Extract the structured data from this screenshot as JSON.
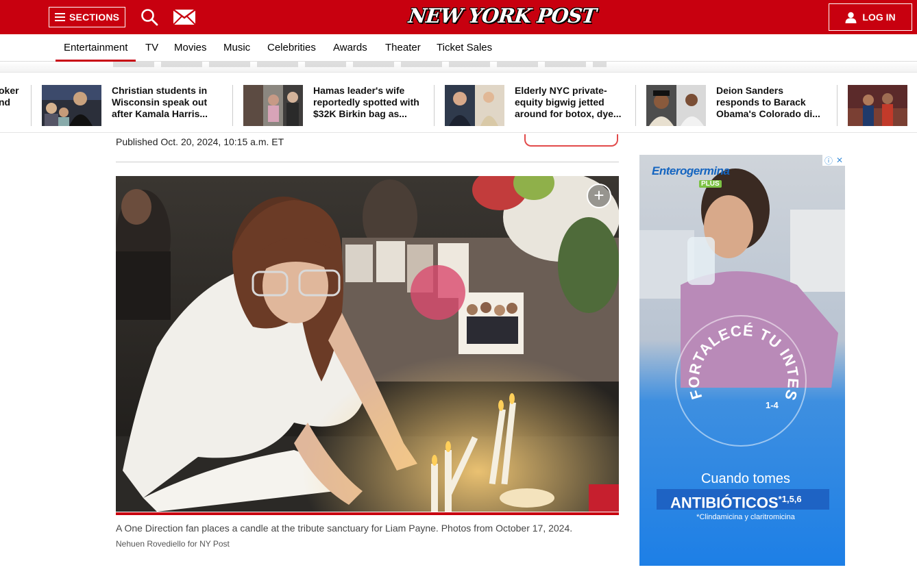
{
  "header": {
    "sections_label": "SECTIONS",
    "logo_text": "NEW YORK POST",
    "login_label": "LOG IN",
    "brand_red": "#c8000f",
    "icons": [
      "menu-icon",
      "search-icon",
      "mail-icon",
      "user-icon"
    ]
  },
  "nav": {
    "items": [
      "Entertainment",
      "TV",
      "Movies",
      "Music",
      "Celebrities",
      "Awards",
      "Theater",
      "Ticket Sales"
    ],
    "active": "Entertainment"
  },
  "trending": {
    "partial_title_lines": [
      "oker",
      "nd"
    ],
    "cards": [
      {
        "title": "Christian students in Wisconsin speak out after Kamala Harris..."
      },
      {
        "title": "Hamas leader's wife reportedly spotted with $32K Birkin bag as..."
      },
      {
        "title": "Elderly NYC private-equity bigwig jetted around for botox, dye..."
      },
      {
        "title": "Deion Sanders responds to Barack Obama's Colorado di..."
      }
    ]
  },
  "article": {
    "published": "Published Oct. 20, 2024, 10:15 a.m. ET",
    "photo_caption": "A One Direction fan places a candle at the tribute sanctuary for Liam Payne. Photos from October 17, 2024.",
    "photo_credit": "Nehuen Rovediello for NY Post",
    "expand_symbol": "+"
  },
  "ad": {
    "brand": "Enterogermina",
    "brand_sub": "PLUS",
    "circle_text": "FORTALECÉ TU INTESTINO",
    "circle_superscript": "1-4",
    "line1": "Cuando tomes",
    "line2": "ANTIBIÓTICOS",
    "line2_superscript": "*1,5,6",
    "line3": "*Clindamicina y claritromicina",
    "adchoices_info": "ⓘ",
    "adchoices_close": "✕"
  }
}
